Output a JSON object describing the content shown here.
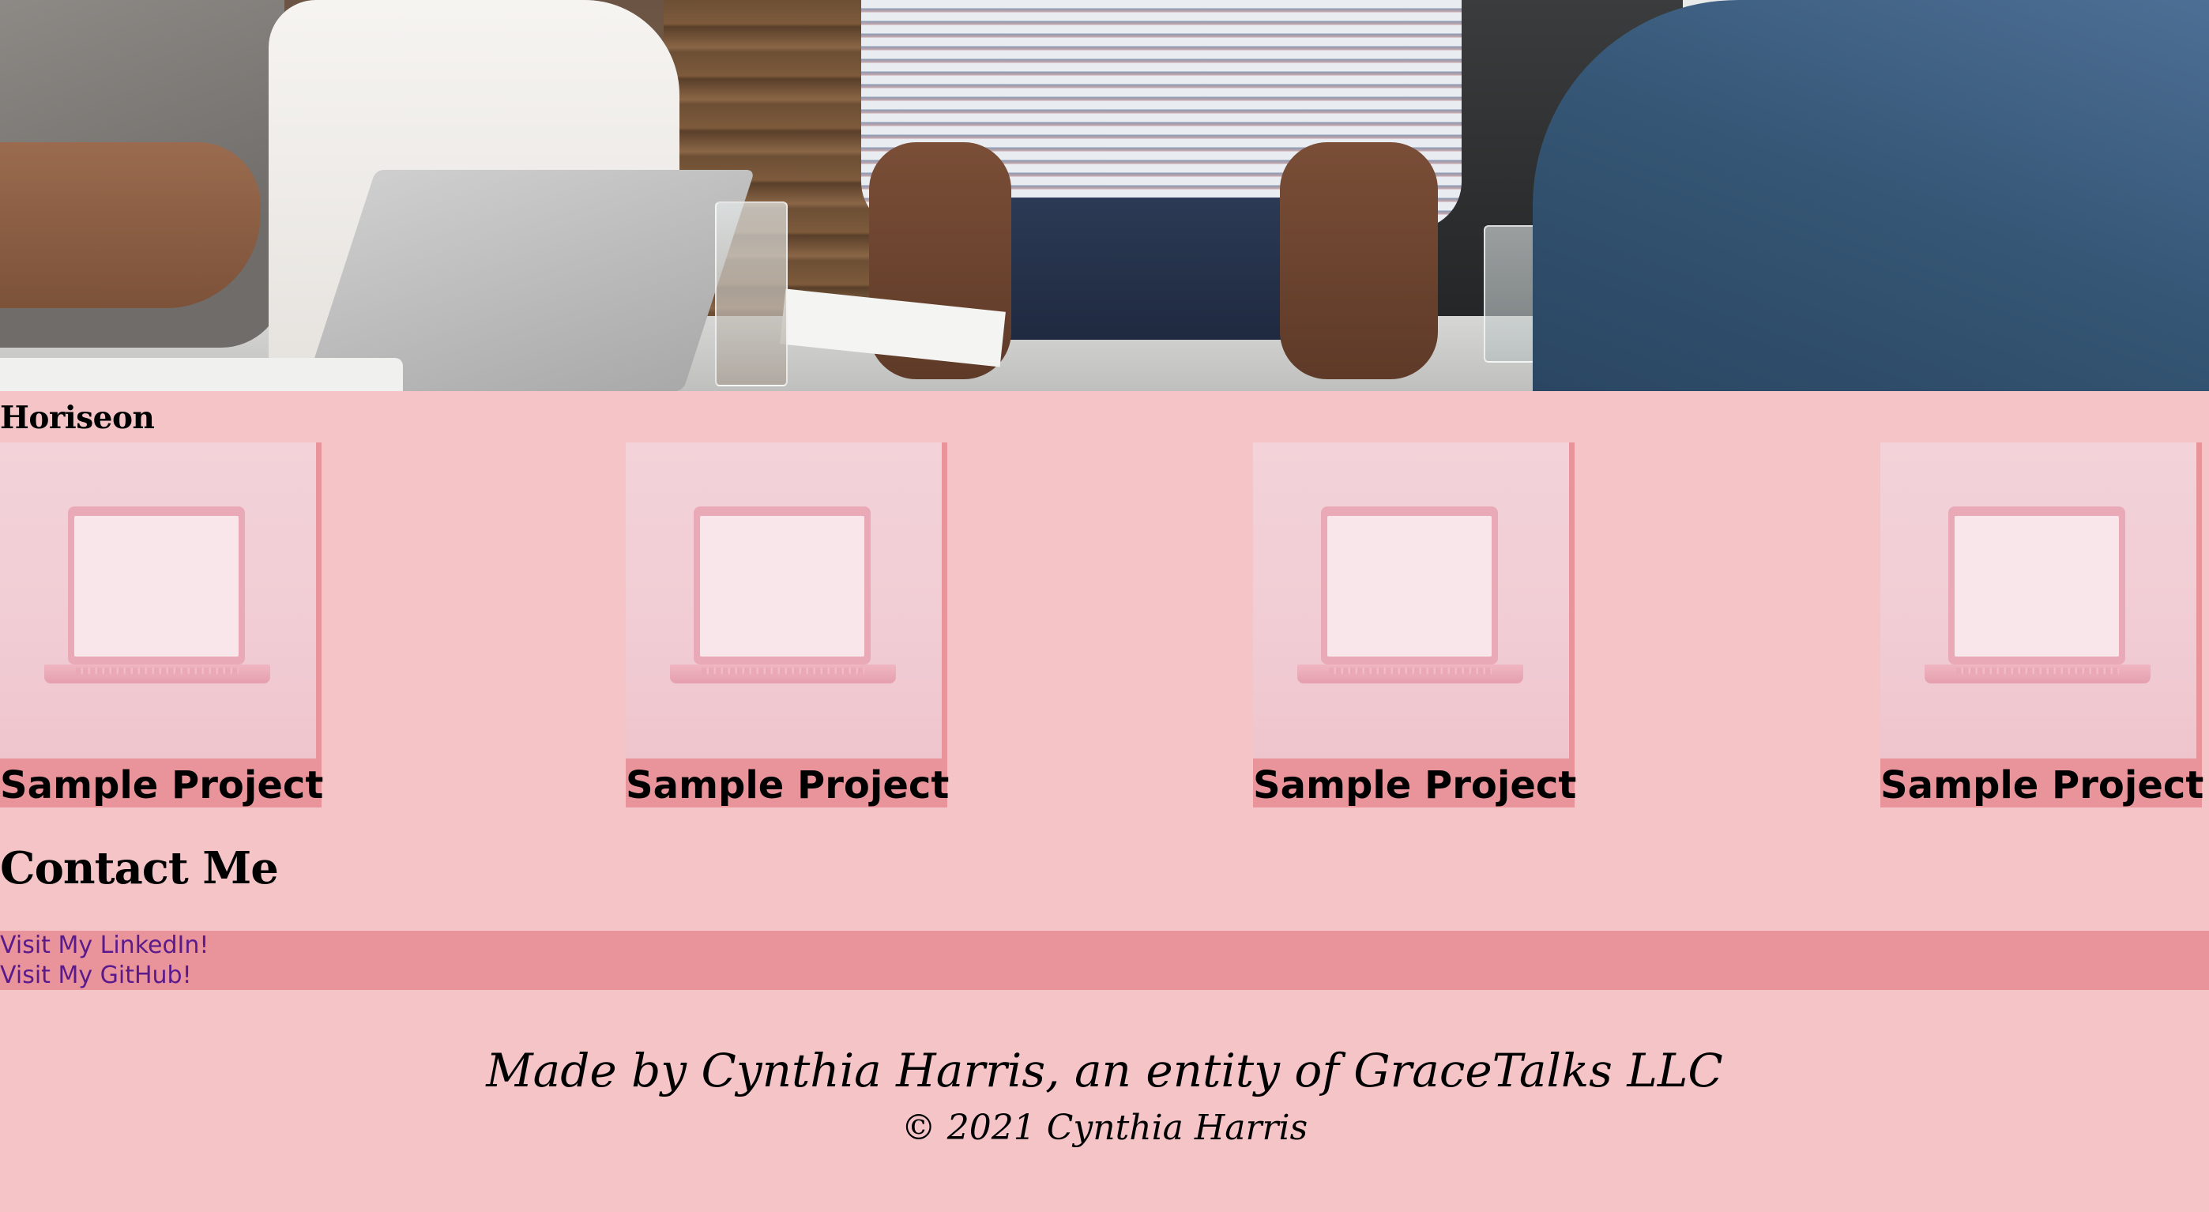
{
  "header": {
    "brand": "Horiseon"
  },
  "projects": [
    {
      "title": "Sample Project",
      "icon": "laptop-icon"
    },
    {
      "title": "Sample Project",
      "icon": "laptop-icon"
    },
    {
      "title": "Sample Project",
      "icon": "laptop-icon"
    },
    {
      "title": "Sample Project",
      "icon": "laptop-icon"
    }
  ],
  "contact": {
    "heading": "Contact Me",
    "links": [
      {
        "label": "Visit My LinkedIn!"
      },
      {
        "label": "Visit My GitHub!"
      }
    ]
  },
  "footer": {
    "made_by": "Made by Cynthia Harris, an entity of GraceTalks LLC",
    "copyright": "© 2021 Cynthia Harris"
  },
  "colors": {
    "page_background": "#f4c4c7",
    "accent": "#e8949a",
    "link": "#5a1a8c"
  }
}
